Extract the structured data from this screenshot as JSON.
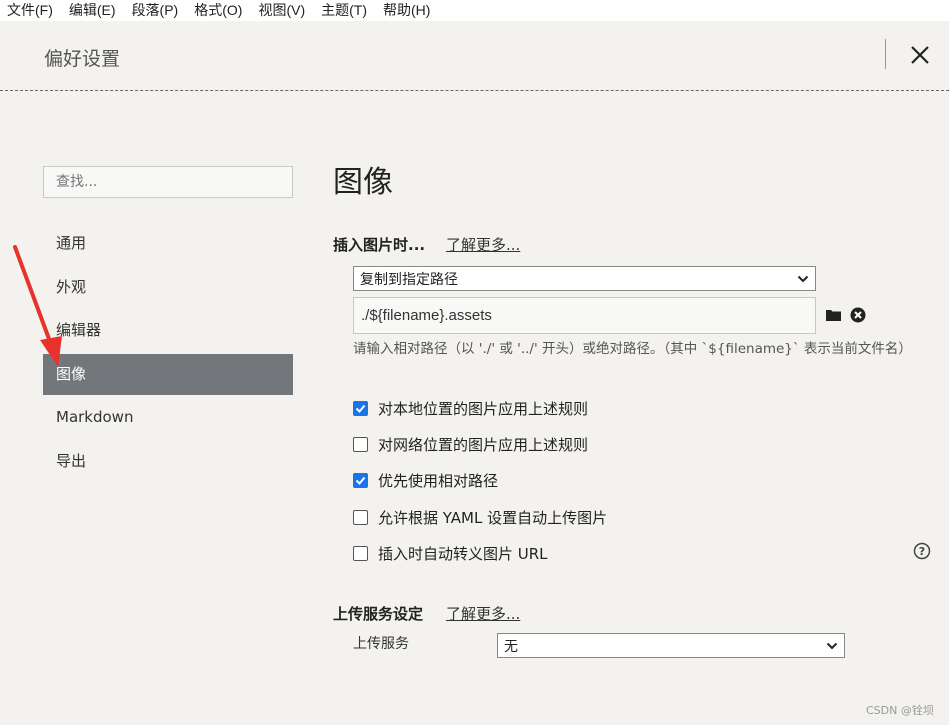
{
  "menu": [
    "文件(F)",
    "编辑(E)",
    "段落(P)",
    "格式(O)",
    "视图(V)",
    "主题(T)",
    "帮助(H)"
  ],
  "dialog": {
    "title": "偏好设置"
  },
  "sidebar": {
    "search_placeholder": "查找...",
    "items": [
      {
        "label": "通用"
      },
      {
        "label": "外观"
      },
      {
        "label": "编辑器"
      },
      {
        "label": "图像",
        "active": true
      },
      {
        "label": "Markdown"
      },
      {
        "label": "导出"
      }
    ]
  },
  "main": {
    "title": "图像",
    "insert_section": {
      "heading": "插入图片时...",
      "learn_more": "了解更多...",
      "action_select": "复制到指定路径",
      "path_value": "./${filename}.assets",
      "hint": "请输入相对路径（以 './' 或 '../' 开头）或绝对路径。（其中 `${filename}` 表示当前文件名）",
      "options": [
        {
          "label": "对本地位置的图片应用上述规则",
          "checked": true
        },
        {
          "label": "对网络位置的图片应用上述规则",
          "checked": false
        },
        {
          "label": "优先使用相对路径",
          "checked": true
        },
        {
          "label": "允许根据 YAML 设置自动上传图片",
          "checked": false
        },
        {
          "label": "插入时自动转义图片 URL",
          "checked": false
        }
      ]
    },
    "upload_section": {
      "heading": "上传服务设定",
      "learn_more": "了解更多...",
      "service_label": "上传服务",
      "service_value": "无"
    }
  },
  "watermark": "CSDN @铨坝",
  "colors": {
    "accent": "#1a73e8",
    "active_nav": "#73767a",
    "annotation": "#e8322b"
  }
}
